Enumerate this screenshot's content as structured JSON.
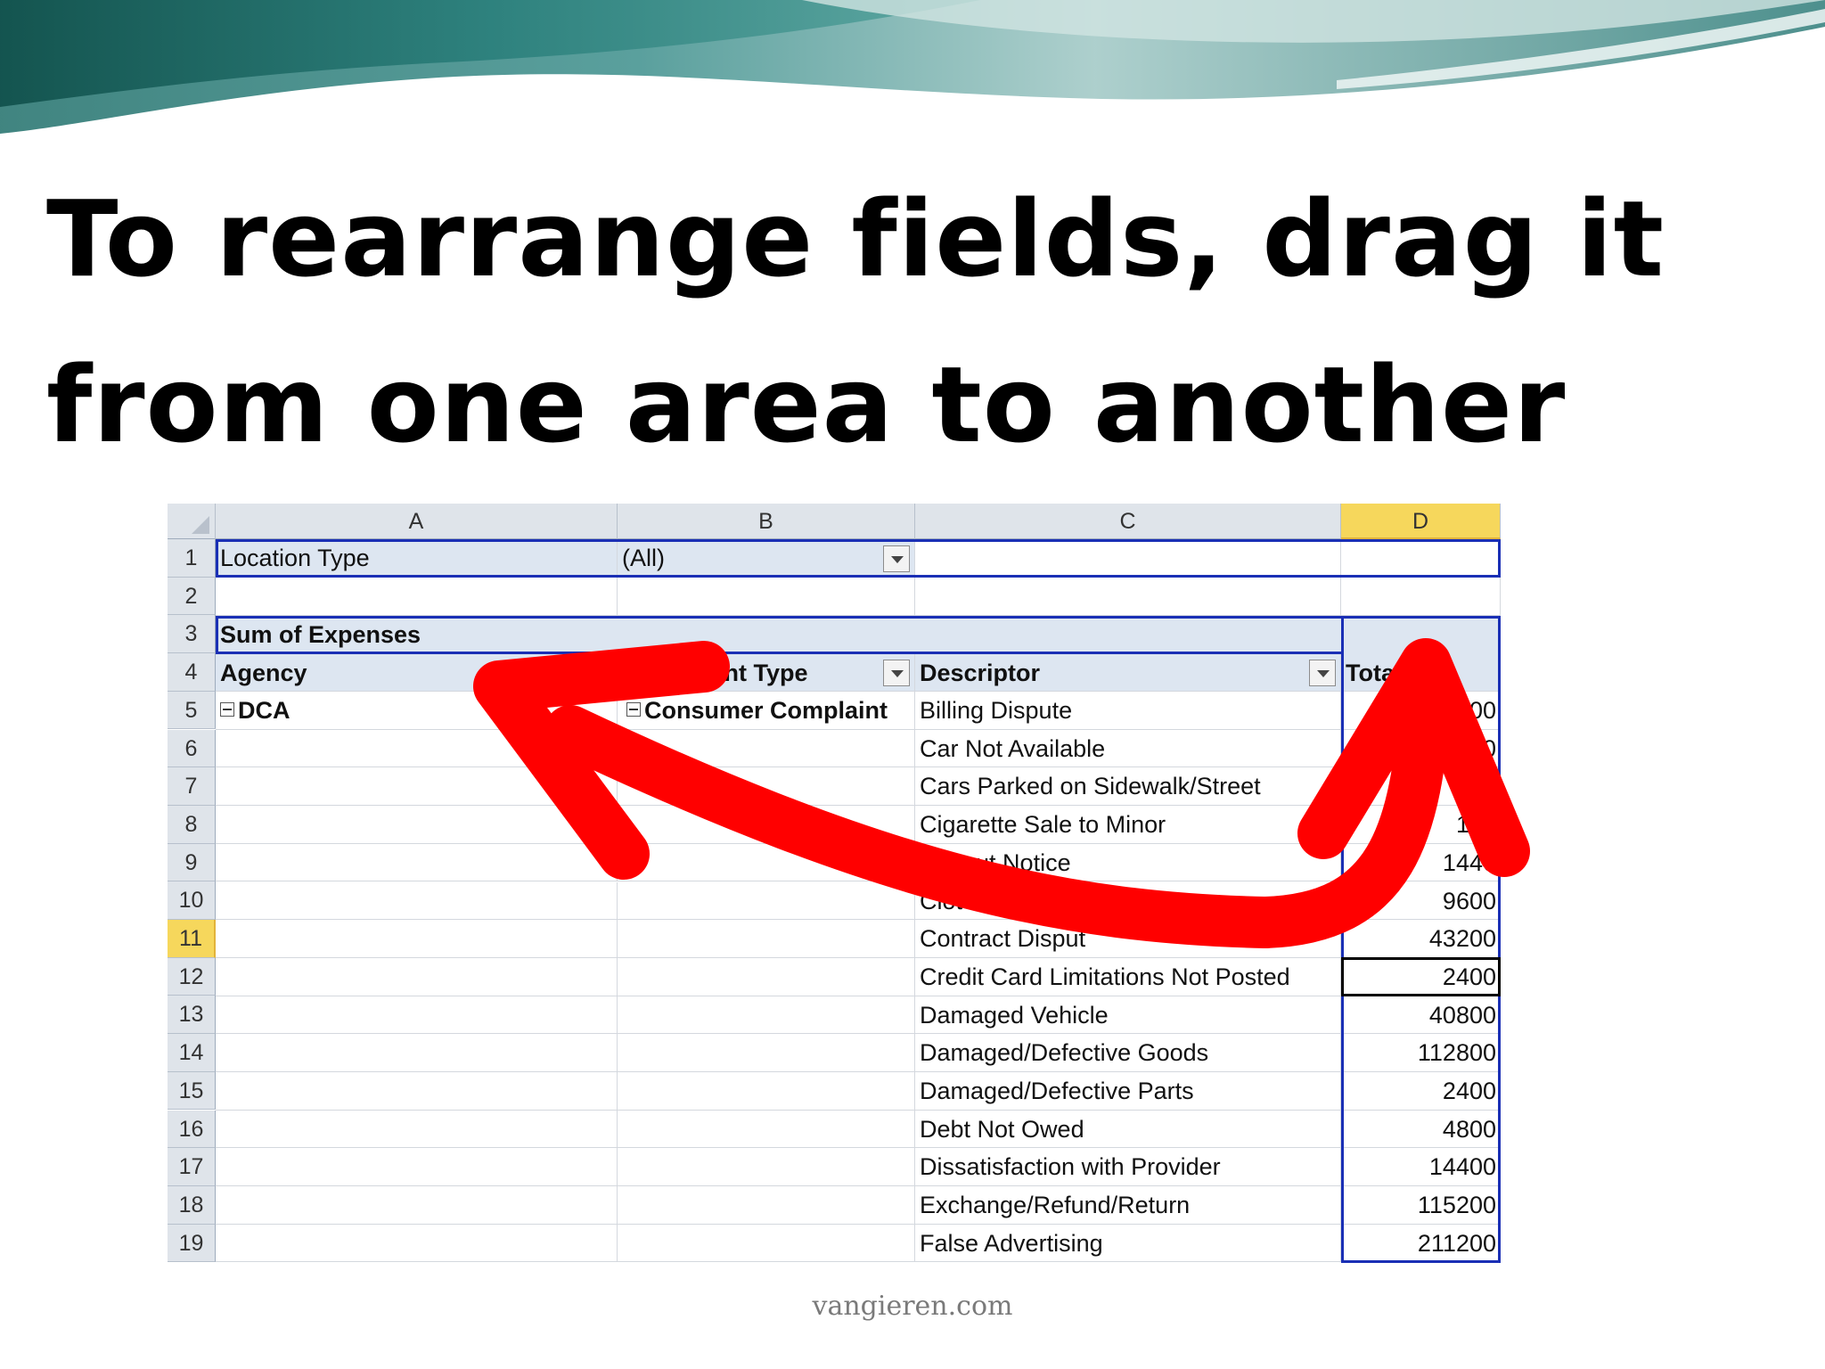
{
  "slide": {
    "title_line1": "To rearrange fields, drag it",
    "title_line2": "from one area to another",
    "footer": "vangieren.com",
    "accent_color": "#ff0000"
  },
  "spreadsheet": {
    "columns": [
      "A",
      "B",
      "C",
      "D"
    ],
    "active_column": "D",
    "row_numbers": [
      "1",
      "2",
      "3",
      "4",
      "5",
      "6",
      "7",
      "8",
      "9",
      "10",
      "11",
      "12",
      "13",
      "14",
      "15",
      "16",
      "17",
      "18",
      "19"
    ],
    "active_row": "11",
    "report_filter": {
      "label": "Location Type",
      "value": "(All)"
    },
    "data_field": "Sum of Expenses",
    "headers": {
      "agency": "Agency",
      "complaint_type": "int Type",
      "descriptor": "Descriptor",
      "total": "Total"
    },
    "agency_value": "DCA",
    "complaint_type_value": "Consumer Complaint",
    "rows": [
      {
        "descriptor": "Billing Dispute",
        "total": "300"
      },
      {
        "descriptor": "Car Not Available",
        "total": "0"
      },
      {
        "descriptor": "Cars Parked on Sidewalk/Street",
        "total": ""
      },
      {
        "descriptor": "Cigarette Sale to Minor",
        "total": "120"
      },
      {
        "descriptor": "without Notice",
        "total": "1440"
      },
      {
        "descriptor": "Clot",
        "total": "9600"
      },
      {
        "descriptor": "Contract Disput",
        "total": "43200"
      },
      {
        "descriptor": "Credit Card Limitations Not Posted",
        "total": "2400"
      },
      {
        "descriptor": "Damaged Vehicle",
        "total": "40800"
      },
      {
        "descriptor": "Damaged/Defective Goods",
        "total": "112800"
      },
      {
        "descriptor": "Damaged/Defective Parts",
        "total": "2400"
      },
      {
        "descriptor": "Debt Not Owed",
        "total": "4800"
      },
      {
        "descriptor": "Dissatisfaction with Provider",
        "total": "14400"
      },
      {
        "descriptor": "Exchange/Refund/Return",
        "total": "115200"
      },
      {
        "descriptor": "False Advertising",
        "total": "211200"
      }
    ]
  }
}
